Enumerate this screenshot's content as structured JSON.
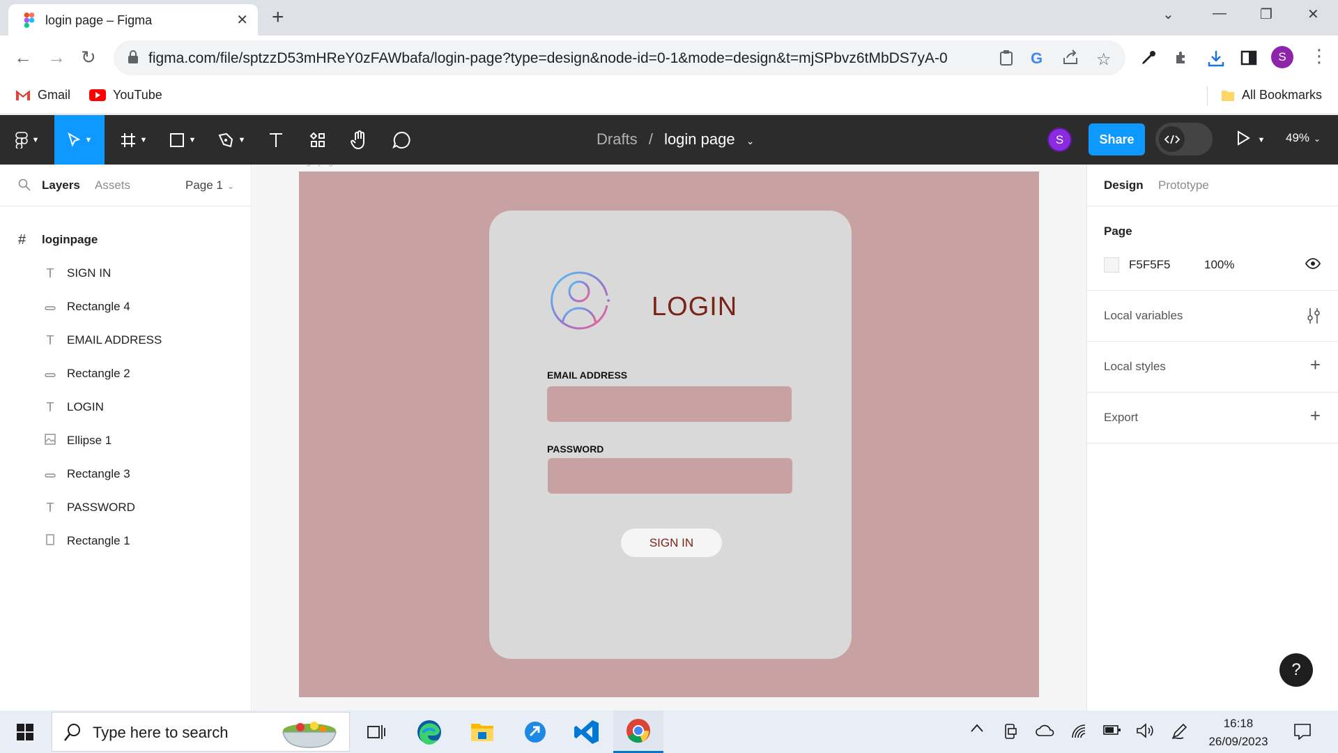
{
  "browser": {
    "tab_title": "login page – Figma",
    "url": "figma.com/file/sptzzD53mHReY0zFAWbafa/login-page?type=design&node-id=0-1&mode=design&t=mjSPbvz6tMbDS7yA-0",
    "profile_initial": "S",
    "bookmarks": [
      {
        "label": "Gmail",
        "icon": "gmail-icon"
      },
      {
        "label": "YouTube",
        "icon": "youtube-icon"
      }
    ],
    "all_bookmarks": "All Bookmarks"
  },
  "figma_toolbar": {
    "breadcrumb_parent": "Drafts",
    "breadcrumb_separator": "/",
    "file_name": "login page",
    "user_initial": "S",
    "share_label": "Share",
    "zoom": "49%"
  },
  "left_panel": {
    "tabs": [
      "Layers",
      "Assets"
    ],
    "page_selector": "Page 1",
    "frame_name": "loginpage",
    "layers": [
      {
        "label": "SIGN IN",
        "icon": "text-icon"
      },
      {
        "label": "Rectangle 4",
        "icon": "rectangle-icon"
      },
      {
        "label": "EMAIL ADDRESS",
        "icon": "text-icon"
      },
      {
        "label": "Rectangle 2",
        "icon": "rectangle-icon"
      },
      {
        "label": "LOGIN",
        "icon": "text-icon"
      },
      {
        "label": "Ellipse 1",
        "icon": "image-icon"
      },
      {
        "label": "Rectangle 3",
        "icon": "rectangle-icon"
      },
      {
        "label": "PASSWORD",
        "icon": "text-icon"
      },
      {
        "label": "Rectangle 1",
        "icon": "rectangle-icon"
      }
    ]
  },
  "canvas": {
    "frame_label": "loginpage",
    "frame_color": "#c8a2a2",
    "login_title": "LOGIN",
    "email_label": "EMAIL ADDRESS",
    "password_label": "PASSWORD",
    "signin_label": "SIGN IN"
  },
  "right_panel": {
    "tabs": [
      "Design",
      "Prototype"
    ],
    "page_heading": "Page",
    "page_color": "F5F5F5",
    "page_opacity": "100%",
    "local_variables": "Local variables",
    "local_styles": "Local styles",
    "export": "Export",
    "help": "?"
  },
  "taskbar": {
    "search_placeholder": "Type here to search",
    "time": "16:18",
    "date": "26/09/2023"
  }
}
